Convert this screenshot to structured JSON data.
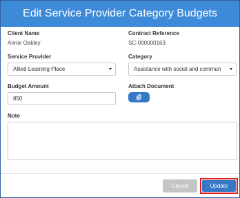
{
  "dialog": {
    "title": "Edit Service Provider Category Budgets"
  },
  "fields": {
    "client_name": {
      "label": "Client Name",
      "value": "Annie Oakley"
    },
    "contract_reference": {
      "label": "Contract Reference",
      "value": "SC-000000163"
    },
    "service_provider": {
      "label": "Service Provider",
      "selected": "Allied Learning Place"
    },
    "category": {
      "label": "Category",
      "selected": "Assistance with social and commun"
    },
    "budget_amount": {
      "label": "Budget Amount",
      "value": "850"
    },
    "attach_document": {
      "label": "Attach Document",
      "icon": "paperclip-icon"
    },
    "note": {
      "label": "Note",
      "value": ""
    }
  },
  "buttons": {
    "cancel_label": "Cancel",
    "update_label": "Update"
  },
  "colors": {
    "titlebar": "#3c8ad8",
    "primary_button": "#3578c4",
    "disabled_button": "#c4c4c4",
    "highlight_outline": "#e02020"
  }
}
